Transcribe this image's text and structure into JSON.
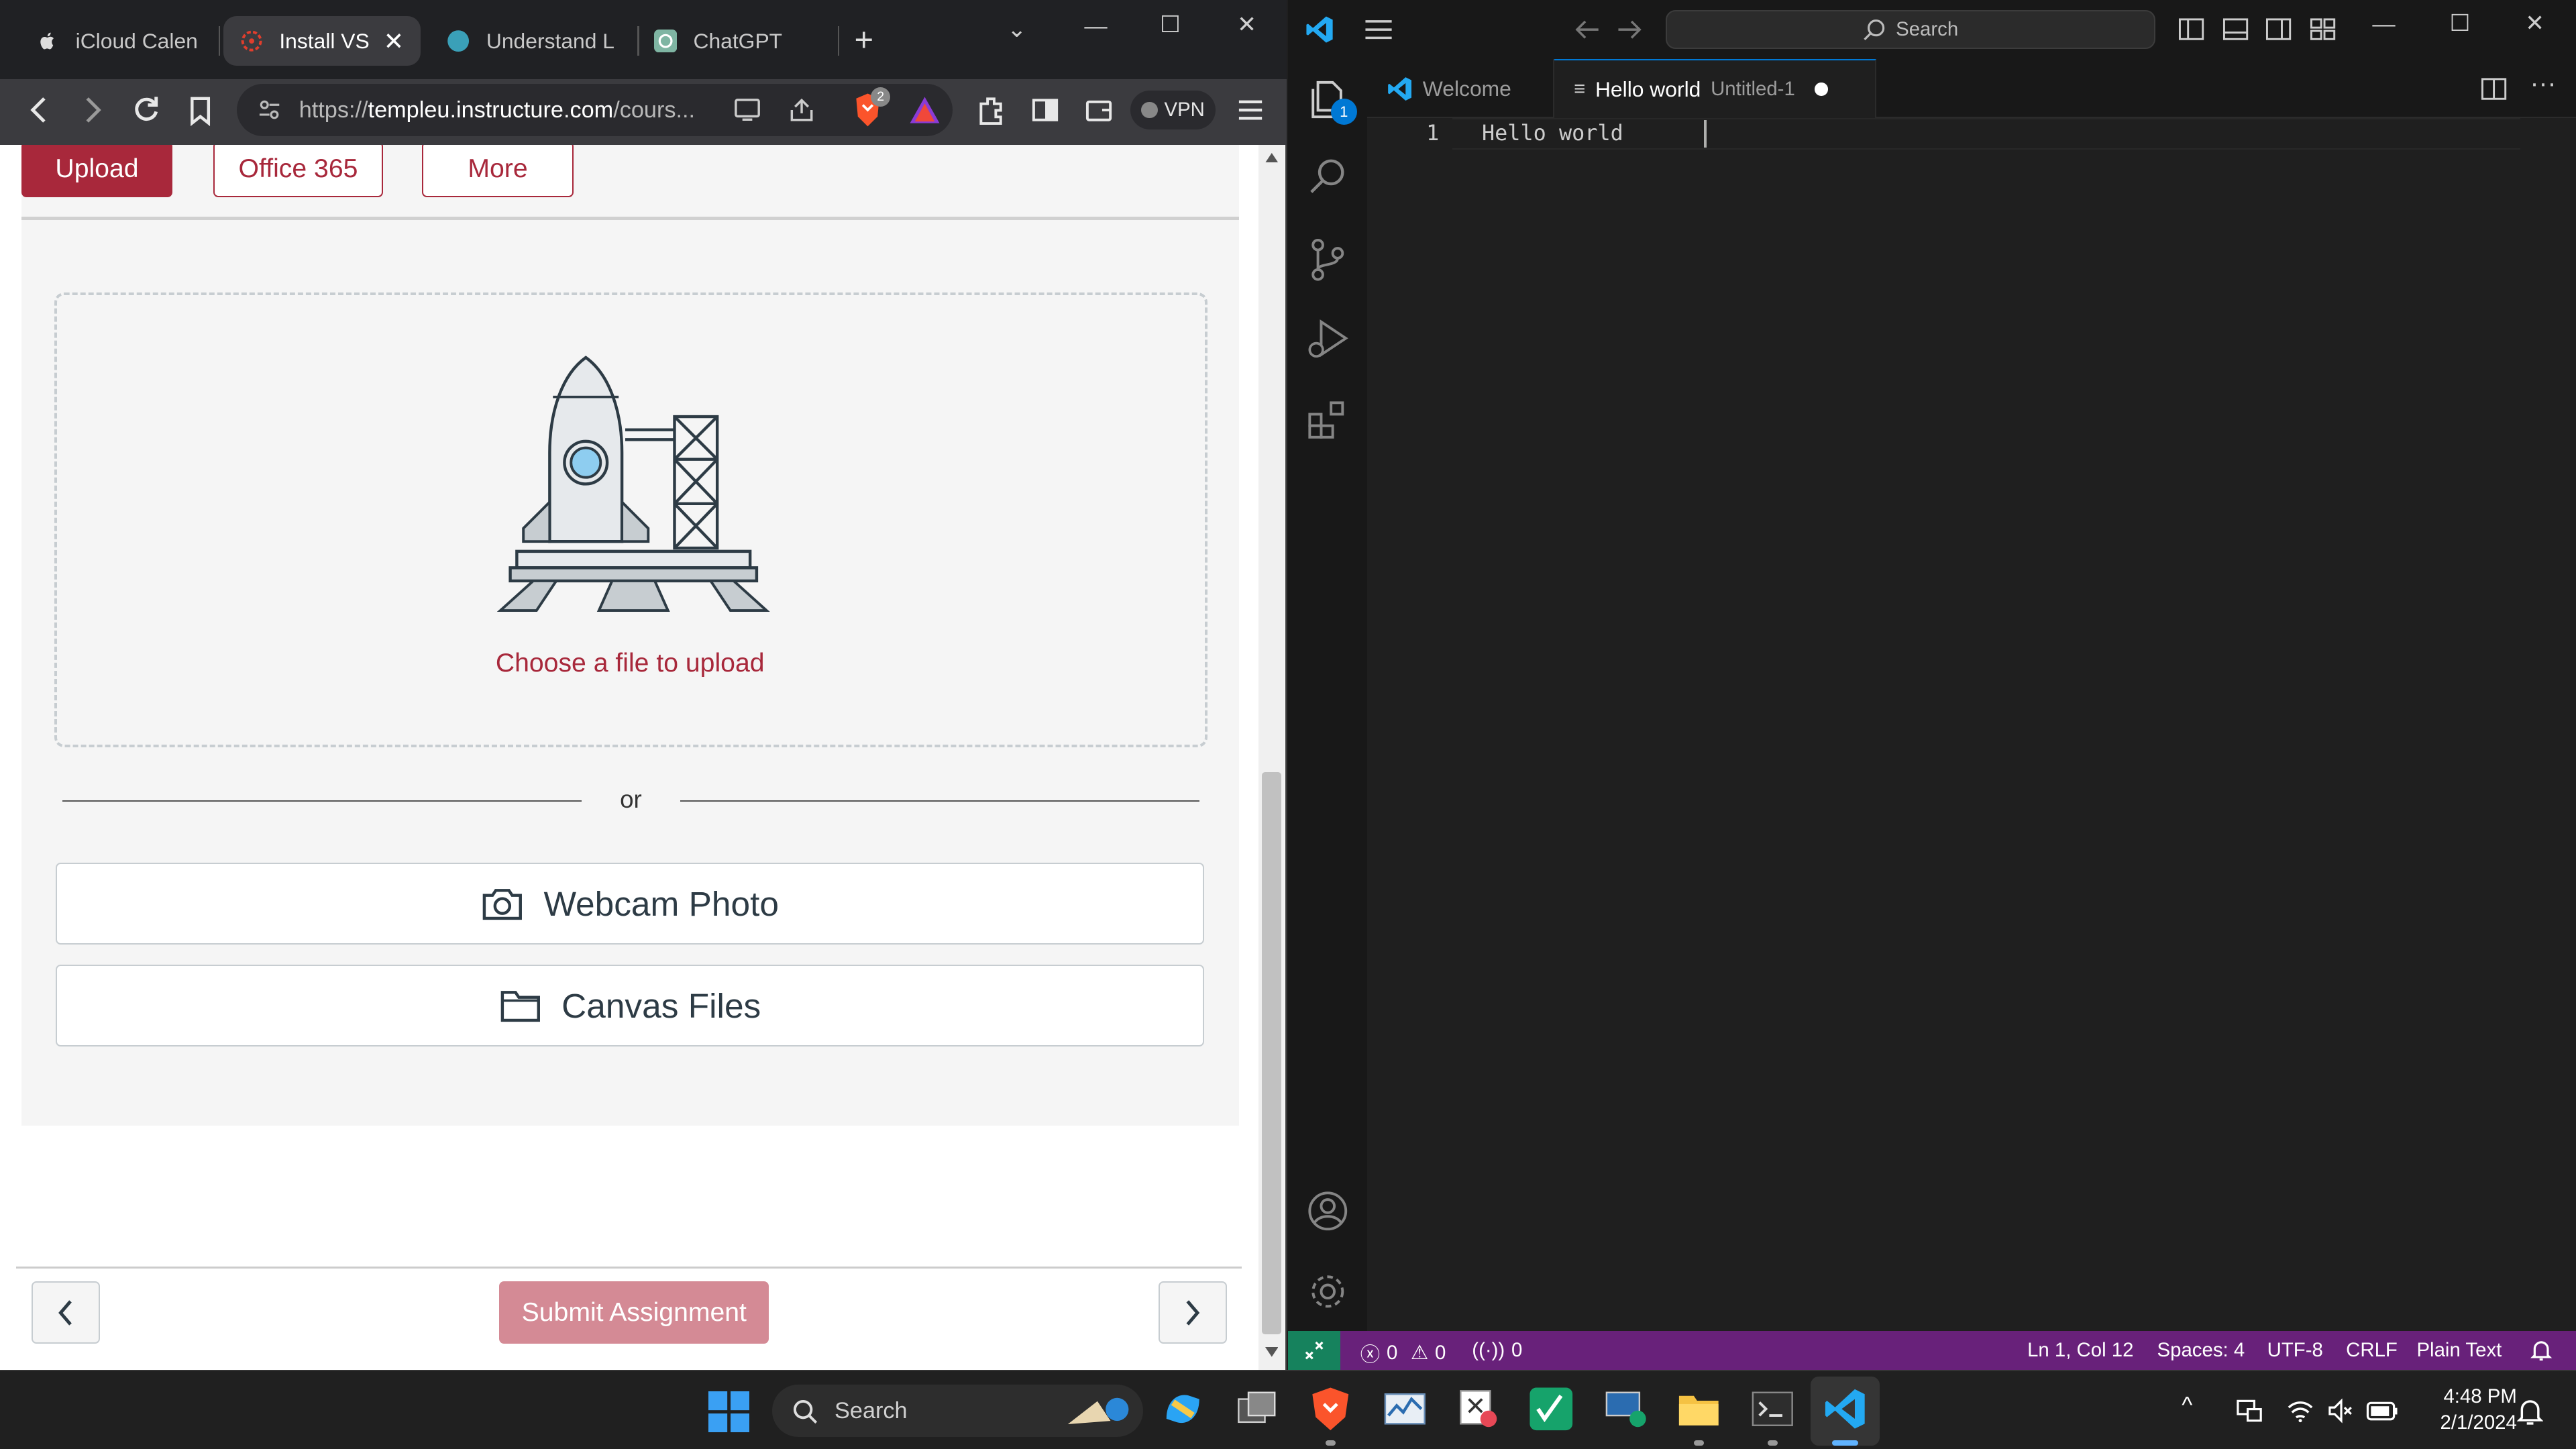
{
  "browser": {
    "tabs": [
      {
        "label": "iCloud Calend",
        "icon": "apple-icon"
      },
      {
        "label": "Install VS",
        "icon": "canvas-icon",
        "active": true
      },
      {
        "label": "Understand Lir",
        "icon": "globe-icon"
      },
      {
        "label": "ChatGPT",
        "icon": "chatgpt-icon"
      }
    ],
    "new_tab": "+",
    "url_prefix": "https://",
    "url_host": "templeu.instructure.com",
    "url_rest": "/cours...",
    "shield_count": "2",
    "vpn_label": "VPN"
  },
  "page": {
    "top_buttons": {
      "upload": "Upload",
      "office": "Office 365",
      "more": "More"
    },
    "choose_file": "Choose a file to upload",
    "or": "or",
    "webcam": "Webcam Photo",
    "canvas_files": "Canvas Files",
    "submit": "Submit Assignment"
  },
  "vscode": {
    "search": "Search",
    "explorer_badge": "1",
    "tabs": {
      "welcome": "Welcome",
      "file": "Hello world",
      "file_desc": "Untitled-1"
    },
    "line_number": "1",
    "code": "Hello world",
    "status": {
      "errors": "0",
      "warnings": "0",
      "ports": "0",
      "position": "Ln 1, Col 12",
      "spaces": "Spaces: 4",
      "encoding": "UTF-8",
      "eol": "CRLF",
      "language": "Plain Text"
    }
  },
  "taskbar": {
    "search": "Search",
    "time": "4:48 PM",
    "date": "2/1/2024"
  },
  "colors": {
    "canvas_red": "#a8283b",
    "vscode_status": "#68217a",
    "vscode_accent": "#0078d4"
  }
}
